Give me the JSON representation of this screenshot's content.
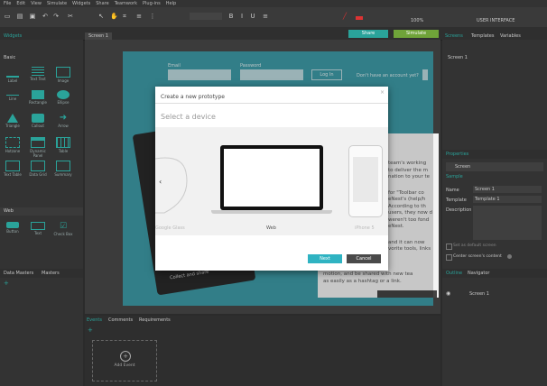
{
  "menu": [
    "File",
    "Edit",
    "View",
    "Simulate",
    "Widgets",
    "Share",
    "Teamwork",
    "Plug-ins",
    "Help"
  ],
  "toolbar": {
    "zoom": "100%",
    "mode": "USER INTERFACE"
  },
  "actions": {
    "share": "Share",
    "simulate": "Simulate"
  },
  "left_tabs": {
    "widgets": "Widgets",
    "data_masters": "Data Masters",
    "masters": "Masters"
  },
  "widget_groups": {
    "basic": "Basic",
    "web": "Web"
  },
  "widgets": [
    "Label",
    "Text Text",
    "Image",
    "Line",
    "Rectangle",
    "Ellipse",
    "Triangle",
    "Callout",
    "Arrow",
    "Hotzone",
    "Dynamic Panel",
    "Table",
    "Text Table",
    "Data Grid",
    "Summary",
    "Button",
    "Text",
    "Check Box"
  ],
  "canvas": {
    "tab": "Screen 1",
    "email_label": "Email",
    "password_label": "Password",
    "login_button": "Log In",
    "signup_prompt": "Don't have an account yet?"
  },
  "background_text": [
    "team's working",
    "to deliver the m",
    "nation to your te",
    "for \"Toolbar co",
    "eNest's (help/h",
    "According to th",
    "users, they now d",
    "weren't too fond",
    "eNest.",
    "and it can now",
    "vorite tools, links",
    "motion, and be shared with new tea",
    "as easily as a hashtag or a link.",
    "Collect and share"
  ],
  "modal": {
    "title": "Create a new prototype",
    "close": "×",
    "subtitle": "Select a device",
    "devices": [
      "Google Glass",
      "Web",
      "iPhone 5"
    ],
    "next": "Next",
    "cancel": "Cancel"
  },
  "right_tabs": [
    "Screens",
    "Templates",
    "Variables"
  ],
  "screens": [
    "Screen 1"
  ],
  "properties": {
    "title": "Properties",
    "screen": "Screen",
    "section": "Sample",
    "name_label": "Name",
    "name_value": "Screen 1",
    "template_label": "Template",
    "template_value": "Template 1",
    "description_label": "Description",
    "adjust": "Set as default screen",
    "center": "Center screen's content"
  },
  "outline_tabs": [
    "Outline",
    "Navigator"
  ],
  "outline_item": "Screen 1",
  "bottom_tabs": [
    "Events",
    "Comments",
    "Requirements"
  ],
  "add_event": "Add Event"
}
